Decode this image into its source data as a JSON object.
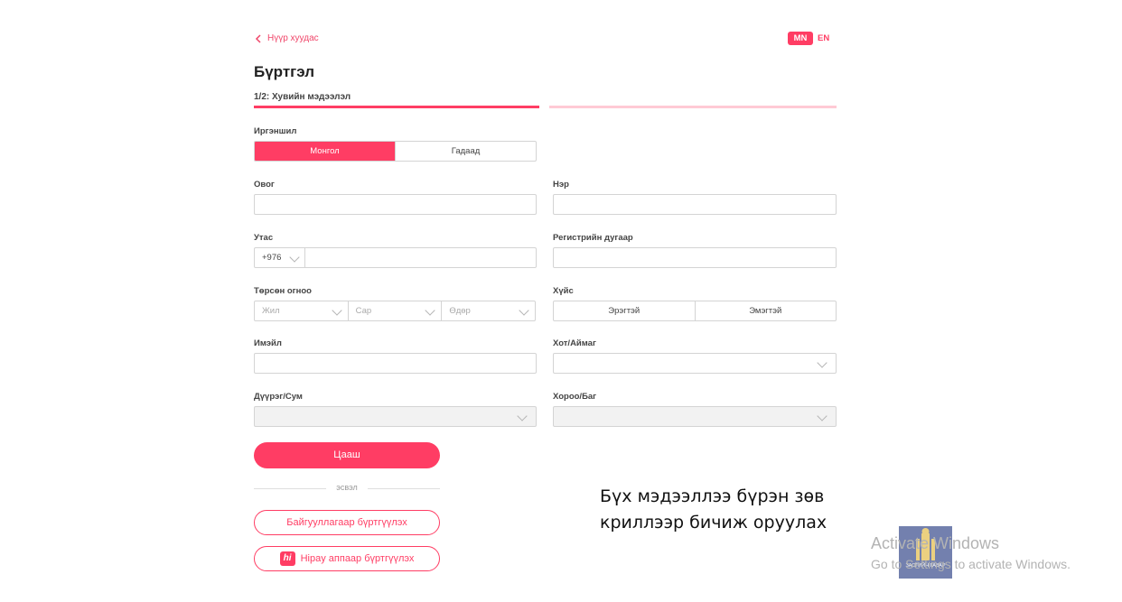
{
  "nav": {
    "back_label": "Нүүр хуудас"
  },
  "lang": {
    "mn": "MN",
    "en": "EN"
  },
  "page": {
    "title": "Бүртгэл",
    "step": "1/2: Хувийн мэдээлэл",
    "progress": 0.5
  },
  "form": {
    "citizenship_label": "Иргэншил",
    "citizenship_options": [
      "Монгол",
      "Гадаад"
    ],
    "surname_label": "Овог",
    "name_label": "Нэр",
    "phone_label": "Утас",
    "phone_code": "+976",
    "register_label": "Регистрийн дугаар",
    "birthdate_label": "Төрсөн огноо",
    "birth_year_placeholder": "Жил",
    "birth_month_placeholder": "Сар",
    "birth_day_placeholder": "Өдөр",
    "gender_label": "Хүйс",
    "gender_options": [
      "Эрэгтэй",
      "Эмэгтэй"
    ],
    "email_label": "Имэйл",
    "city_label": "Хот/Аймаг",
    "district_label": "Дүүрэг/Сум",
    "khoroo_label": "Хороо/Баг"
  },
  "actions": {
    "next": "Цааш",
    "or": "эсвэл",
    "org_register": "Байгууллагаар бүртгүүлэх",
    "hipay_logo": "hi",
    "hipay_register": "Hipay аппаар бүртгүүлэх"
  },
  "note": {
    "line1": "Бүх мэдээллээ бүрэн зөв",
    "line2": "криллээр бичиж оруулах"
  },
  "overlay": {
    "emblem_text": "ЗАСГИЙН ГАЗАР",
    "activate_title": "Activate Windows",
    "activate_sub": "Go to Settings to activate Windows."
  },
  "colors": {
    "accent": "#ff3d64",
    "accent_light": "#ffcad5"
  }
}
